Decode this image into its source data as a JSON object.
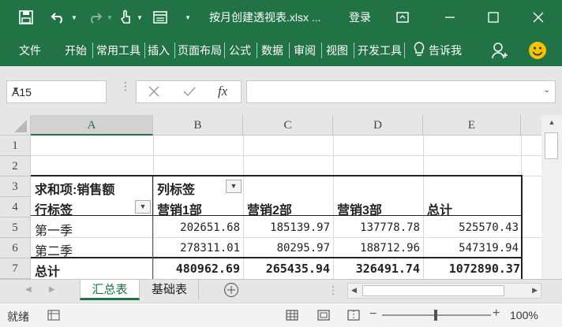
{
  "titlebar": {
    "document_title": "按月创建透视表.xlsx ...",
    "login": "登录",
    "icons": [
      "save-icon",
      "undo-icon",
      "redo-icon",
      "touch-mode-icon",
      "form-icon",
      "customize-qat-icon",
      "ribbon-display-icon",
      "minimize-icon",
      "maximize-icon",
      "close-icon"
    ]
  },
  "ribbon": {
    "tabs": [
      "文件",
      "开始",
      "常用工具",
      "插入",
      "页面布局",
      "公式",
      "数据",
      "审阅",
      "视图",
      "开发工具"
    ],
    "tell_me": "告诉我",
    "accent_color": "#217346"
  },
  "formula_bar": {
    "name_box": "A15",
    "formula_value": ""
  },
  "grid": {
    "columns": [
      "A",
      "B",
      "C",
      "D",
      "E"
    ],
    "selected_column": "A",
    "rows": [
      "1",
      "2",
      "3",
      "4",
      "5",
      "6",
      "7"
    ],
    "pivot": {
      "value_label": "求和项:销售额",
      "col_label": "列标签",
      "row_label": "行标签",
      "col_headers": [
        "营销1部",
        "营销2部",
        "营销3部",
        "总计"
      ],
      "rows": [
        {
          "label": "第一季",
          "values": [
            "202651.68",
            "185139.97",
            "137778.78",
            "525570.43"
          ]
        },
        {
          "label": "第二季",
          "values": [
            "278311.01",
            "80295.97",
            "188712.96",
            "547319.94"
          ]
        }
      ],
      "total": {
        "label": "总计",
        "values": [
          "480962.69",
          "265435.94",
          "326491.74",
          "1072890.37"
        ]
      }
    }
  },
  "sheets": {
    "tabs": [
      "汇总表",
      "基础表"
    ],
    "active": "汇总表"
  },
  "status": {
    "text": "就绪",
    "zoom": "100%"
  }
}
